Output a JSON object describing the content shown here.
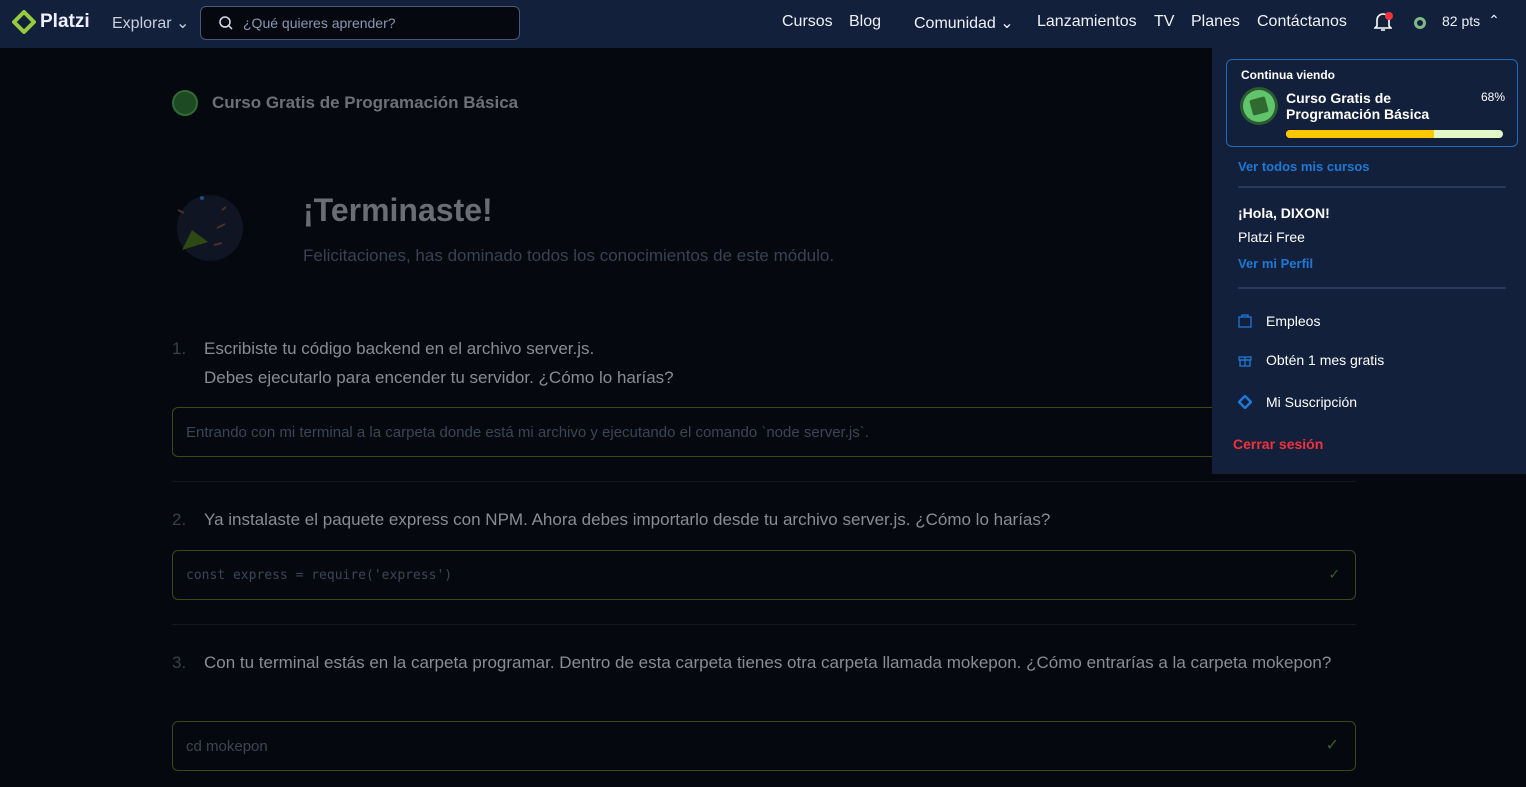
{
  "nav": {
    "logo": "Platzi",
    "explorar": "Explorar",
    "search_placeholder": "¿Qué quieres aprender?",
    "links": [
      "Cursos",
      "Blog",
      "Comunidad",
      "Lanzamientos",
      "TV",
      "Planes",
      "Contáctanos"
    ],
    "points": "82 pts"
  },
  "main": {
    "course": "Curso Gratis de Programación Básica",
    "title": "¡Terminaste!",
    "subtitle": "Felicitaciones, has dominado todos los conocimientos de este módulo.",
    "questions": [
      {
        "num": "1.",
        "text": "Escribiste tu código backend en el archivo server.js.",
        "text2": "Debes ejecutarlo para encender tu servidor. ¿Cómo lo harías?",
        "answer": "Entrando con mi terminal a la carpeta donde está mi archivo y ejecutando el comando `node server.js`."
      },
      {
        "num": "2.",
        "text": "Ya instalaste el paquete express con NPM. Ahora debes importarlo desde tu archivo server.js. ¿Cómo lo harías?",
        "answer": "const express = require('express')"
      },
      {
        "num": "3.",
        "text": "Con tu terminal estás en la carpeta programar. Dentro de esta carpeta tienes otra carpeta llamada mokepon. ¿Cómo entrarías a la carpeta mokepon?",
        "answer": "cd mokepon"
      }
    ]
  },
  "dropdown": {
    "continue": "Continua viendo",
    "course": "Curso Gratis de Programación Básica",
    "percent": "68%",
    "progress": 68,
    "all_courses": "Ver todos mis cursos",
    "greeting": "¡Hola, DIXON!",
    "plan": "Platzi Free",
    "profile": "Ver mi Perfil",
    "items": [
      "Empleos",
      "Obtén 1 mes gratis",
      "Mi Suscripción"
    ],
    "logout": "Cerrar sesión"
  },
  "colors": {
    "accent": "#98ca3f",
    "link": "#1e78d6",
    "danger": "#f0323c",
    "progress": "#ffc700"
  }
}
